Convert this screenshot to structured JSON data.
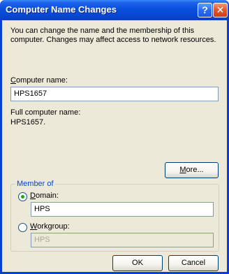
{
  "window": {
    "title": "Computer Name Changes",
    "help_glyph": "?",
    "close_glyph": "✕"
  },
  "description": "You can change the name and the membership of this computer. Changes may affect access to network resources.",
  "computer_name": {
    "label_accel": "C",
    "label_rest": "omputer name:",
    "value": "HPS1657"
  },
  "full_name": {
    "label": "Full computer name:",
    "value": "HPS1657."
  },
  "more_button": {
    "accel": "M",
    "rest": "ore..."
  },
  "member_of": {
    "legend": "Member of",
    "domain": {
      "accel": "D",
      "rest": "omain:",
      "selected": true,
      "value": "HPS"
    },
    "workgroup": {
      "accel": "W",
      "rest": "orkgroup:",
      "selected": false,
      "value": "HPS",
      "enabled": false
    }
  },
  "buttons": {
    "ok": "OK",
    "cancel": "Cancel"
  }
}
